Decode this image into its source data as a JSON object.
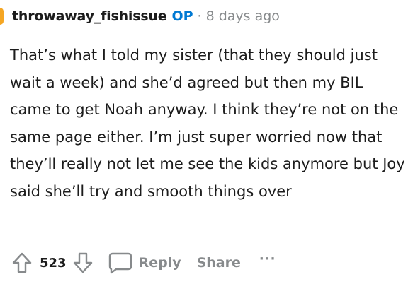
{
  "comment": {
    "author": "throwaway_fishissue",
    "op_label": "OP",
    "separator": "·",
    "timestamp": "8 days ago",
    "body": "That’s what I told my sister (that they should just wait a week) and she’d agreed but then my BIL came to get Noah anyway. I think they’re not on the same page either. I’m just super worried now that they’ll really not let me see the kids anymore but Joy said she’ll try and smooth things over"
  },
  "actions": {
    "score": "523",
    "reply_label": "Reply",
    "share_label": "Share",
    "more_label": "···",
    "upvote_icon": "upvote-arrow",
    "downvote_icon": "downvote-arrow",
    "reply_icon": "speech-bubble"
  },
  "colors": {
    "op_accent": "#0079d3",
    "muted_text": "#878a8c",
    "avatar_accent": "#f5a623",
    "primary_text": "#1c1c1c"
  }
}
